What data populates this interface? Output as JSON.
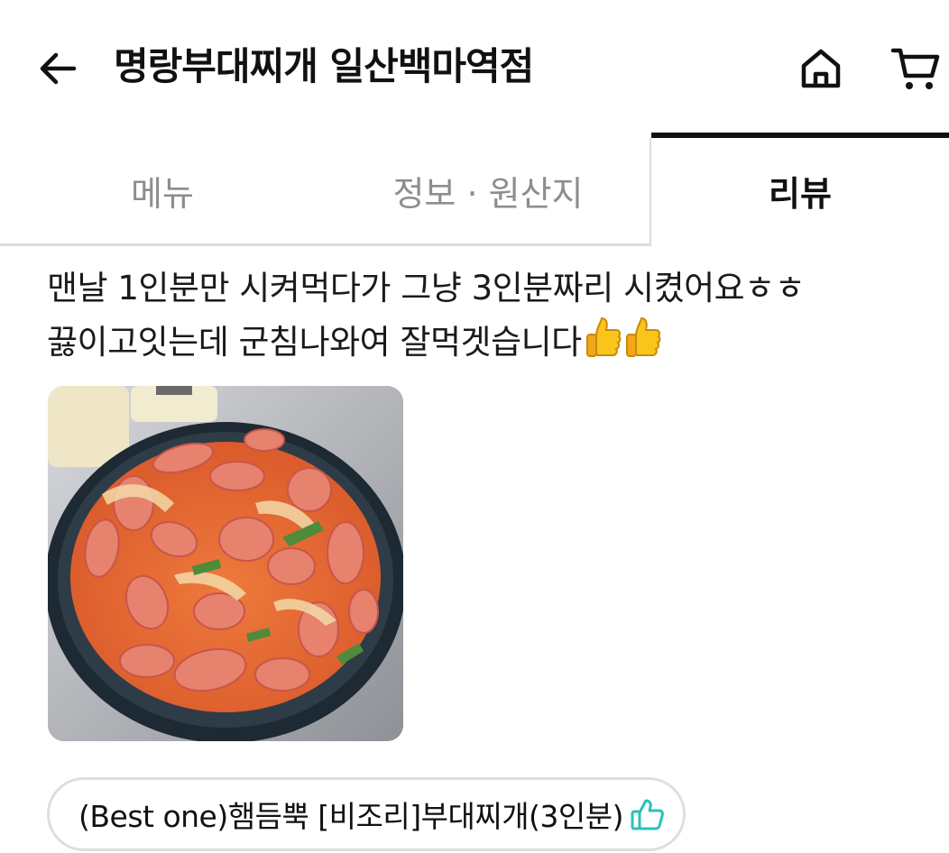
{
  "header": {
    "title": "명랑부대찌개 일산백마역점",
    "icons": [
      "arrow-left-icon",
      "home-icon",
      "cart-icon"
    ]
  },
  "tabs": {
    "items": [
      {
        "label": "메뉴"
      },
      {
        "label": "정보 · 원산지"
      },
      {
        "label": "리뷰"
      }
    ],
    "active": "리뷰"
  },
  "review": {
    "text": "맨날 1인분만 시켜먹다가 그냥 3인분짜리 시켰어요ㅎㅎ 끓이고잇는데 군침나와여 잘먹겟습니다",
    "emoji": "thumbs-up-icon",
    "photo": "budae-jjigae-photo"
  },
  "ordered_menu": {
    "label": "(Best one)햄듬뿍 [비조리]부대찌개(3인분)",
    "icon": "thumbs-up-outline-icon",
    "icon_color": "#2ac1bc"
  },
  "colors": {
    "text": "#111111",
    "inactive_tab": "#8d8d8d",
    "divider": "#dcdcdc",
    "accent": "#2ac1bc"
  }
}
